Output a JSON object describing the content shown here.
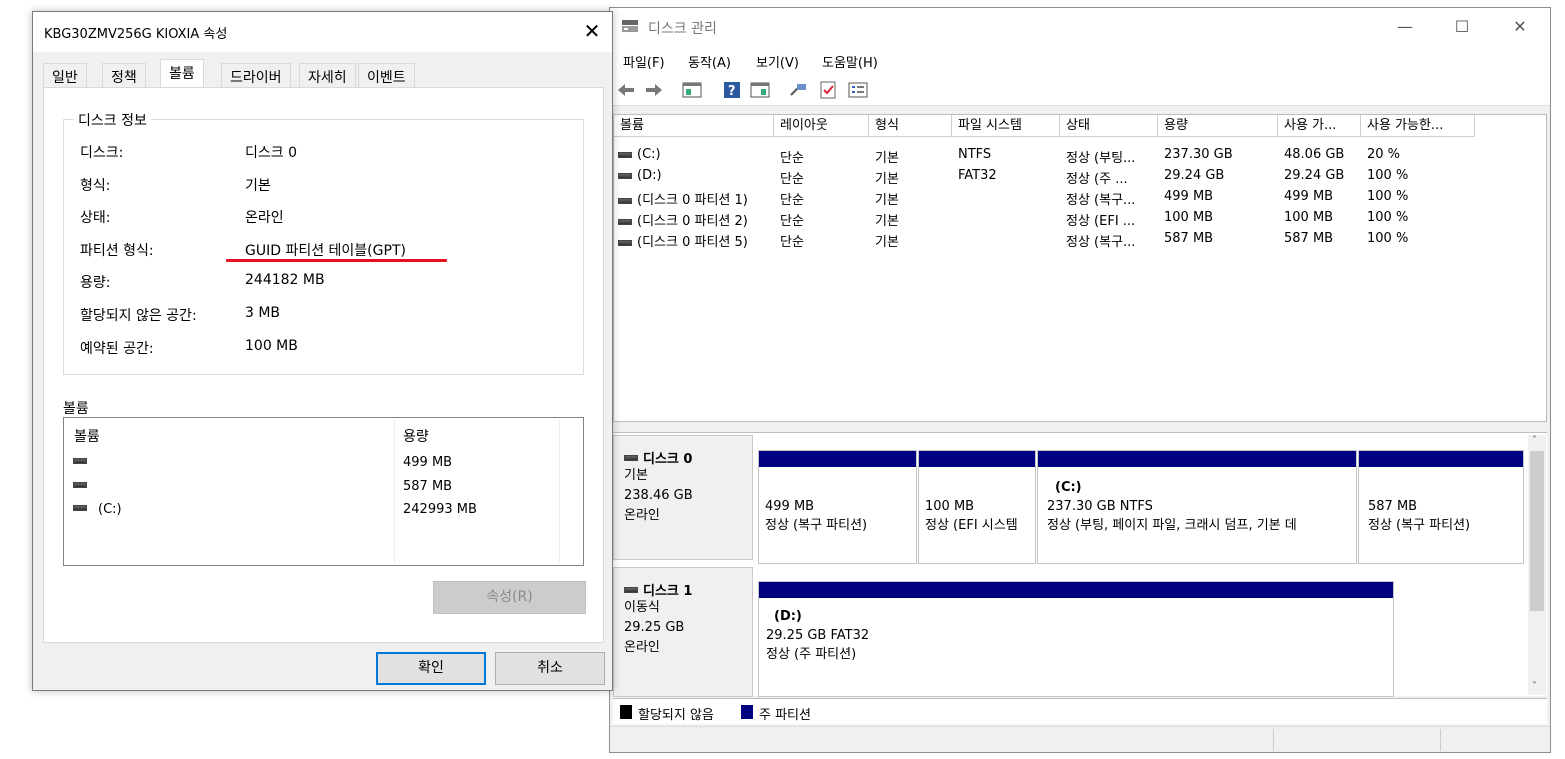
{
  "colors": {
    "primary_partition": "#000080",
    "unallocated": "#000000",
    "underline": "#e81123"
  },
  "disk_mgmt": {
    "title": "디스크 관리",
    "caption_min": "—",
    "caption_max": "☐",
    "caption_close": "✕",
    "menu": [
      "파일(F)",
      "동작(A)",
      "보기(V)",
      "도움말(H)"
    ],
    "columns": [
      "볼륨",
      "레이아웃",
      "형식",
      "파일 시스템",
      "상태",
      "용량",
      "사용 가...",
      "사용 가능한..."
    ],
    "volumes": [
      [
        "(C:)",
        "단순",
        "기본",
        "NTFS",
        "정상 (부팅...",
        "237.30 GB",
        "48.06 GB",
        "20 %"
      ],
      [
        "(D:)",
        "단순",
        "기본",
        "FAT32",
        "정상 (주 ...",
        "29.24 GB",
        "29.24 GB",
        "100 %"
      ],
      [
        "(디스크 0 파티션 1)",
        "단순",
        "기본",
        "",
        "정상 (복구...",
        "499 MB",
        "499 MB",
        "100 %"
      ],
      [
        "(디스크 0 파티션 2)",
        "단순",
        "기본",
        "",
        "정상 (EFI ...",
        "100 MB",
        "100 MB",
        "100 %"
      ],
      [
        "(디스크 0 파티션 5)",
        "단순",
        "기본",
        "",
        "정상 (복구...",
        "587 MB",
        "587 MB",
        "100 %"
      ]
    ],
    "disk0": {
      "name": "디스크 0",
      "type": "기본",
      "size": "238.46 GB",
      "status": "온라인",
      "partitions": [
        {
          "label": "",
          "line1": "499 MB",
          "line2": "정상 (복구 파티션)"
        },
        {
          "label": "",
          "line1": "100 MB",
          "line2": "정상 (EFI 시스템"
        },
        {
          "label": "(C:)",
          "line1": "237.30 GB NTFS",
          "line2": "정상 (부팅, 페이지 파일, 크래시 덤프, 기본 데"
        },
        {
          "label": "",
          "line1": "587 MB",
          "line2": "정상 (복구 파티션)"
        }
      ]
    },
    "disk1": {
      "name": "디스크 1",
      "type": "이동식",
      "size": "29.25 GB",
      "status": "온라인",
      "partitions": [
        {
          "label": "(D:)",
          "line1": "29.25 GB FAT32",
          "line2": "정상 (주 파티션)"
        }
      ]
    },
    "legend": [
      "할당되지 않음",
      "주 파티션"
    ]
  },
  "dialog": {
    "title": "KBG30ZMV256G KIOXIA 속성",
    "close": "✕",
    "tabs": [
      "일반",
      "정책",
      "볼륨",
      "드라이버",
      "자세히",
      "이벤트"
    ],
    "group_title": "디스크 정보",
    "props": [
      {
        "label": "디스크:",
        "value": "디스크 0"
      },
      {
        "label": "형식:",
        "value": "기본"
      },
      {
        "label": "상태:",
        "value": "온라인"
      },
      {
        "label": "파티션 형식:",
        "value": "GUID 파티션 테이블(GPT)"
      },
      {
        "label": "용량:",
        "value": "244182 MB"
      },
      {
        "label": "할당되지 않은 공간:",
        "value": "3 MB"
      },
      {
        "label": "예약된 공간:",
        "value": "100 MB"
      }
    ],
    "volume_section": "볼륨",
    "vol_cols": [
      "볼륨",
      "용량"
    ],
    "vol_rows": [
      {
        "name": "",
        "size": "499 MB"
      },
      {
        "name": "",
        "size": "587 MB"
      },
      {
        "name": "(C:)",
        "size": "242993 MB"
      }
    ],
    "properties_button": "속성(R)",
    "ok": "확인",
    "cancel": "취소"
  }
}
